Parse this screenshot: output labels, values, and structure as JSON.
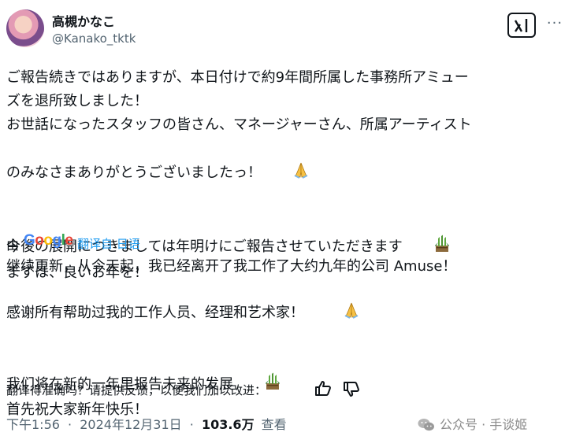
{
  "user": {
    "display_name": "高槻かなこ",
    "handle": "@Kanako_tktk"
  },
  "header": {
    "grok_icon": "grok-icon",
    "more_label": "···"
  },
  "original_text": {
    "line1": "ご報告続きではありますが、本日付けで約9年間所属した事務所アミュー",
    "line2": "ズを退所致しました！",
    "line3": "お世話になったスタッフの皆さん、マネージャーさん、所属アーティスト",
    "line4": "のみなさまありがとうございましたっ！",
    "line5": "今後の展開につきましては年明けにご報告させていただきます",
    "line6": "まずは、良いお年を！",
    "emoji_1": "folded-hands-emoji",
    "emoji_2": "kadomatsu-emoji"
  },
  "translation": {
    "by_label": "由",
    "provider": "Google",
    "translated_from": "翻译自 日语",
    "line1": "继续更新，从今天起，我已经离开了我工作了大约九年的公司 Amuse！",
    "line2": "感谢所有帮助过我的工作人员、经理和艺术家！",
    "line3": "我们将在新的一年里报告未来的发展",
    "line4": "首先祝大家新年快乐！"
  },
  "feedback": {
    "question": "翻译得准确吗？请提供反馈，以便我们加以改进：",
    "thumbs_up_icon": "thumbs-up-icon",
    "thumbs_down_icon": "thumbs-down-icon"
  },
  "meta": {
    "time": "下午1:56",
    "separator": "·",
    "date": "2024年12月31日",
    "views_count": "103.6万",
    "views_label": "查看"
  },
  "watermark": {
    "text": "公众号 · 手谈姬"
  }
}
